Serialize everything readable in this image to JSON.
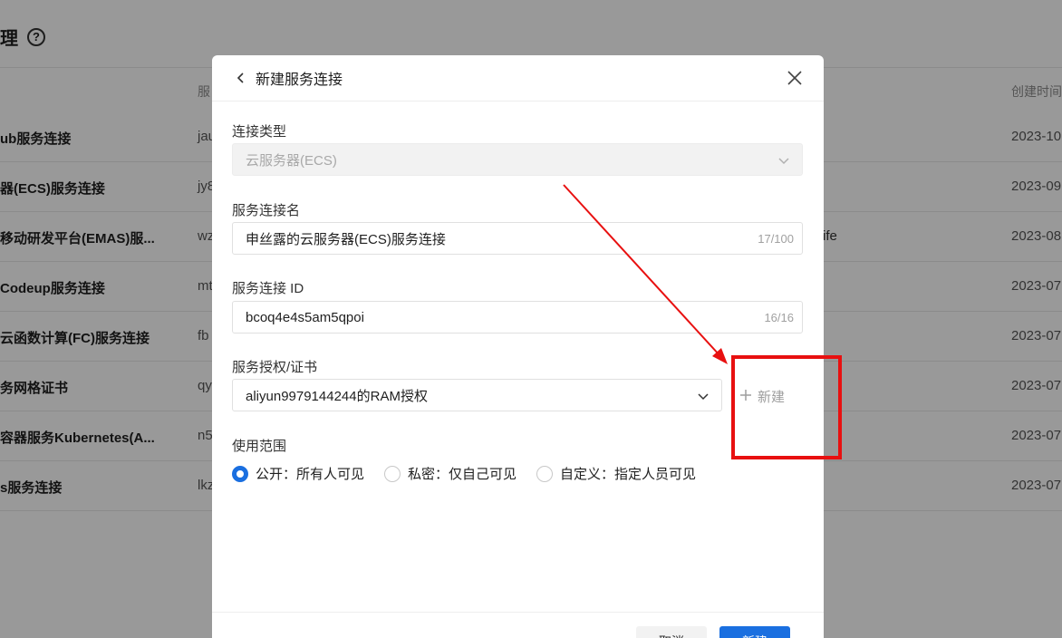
{
  "background": {
    "title": "理",
    "help_icon": "?",
    "column_headers": {
      "id": "服",
      "date": "创建时间"
    },
    "rows": [
      {
        "name": "ub服务连接",
        "id": "jau",
        "extra": "",
        "date": "2023-10"
      },
      {
        "name": "器(ECS)服务连接",
        "id": "jy8",
        "extra": "",
        "date": "2023-09"
      },
      {
        "name": "移动研发平台(EMAS)服...",
        "id": "wz",
        "extra": "ife",
        "date": "2023-08"
      },
      {
        "name": "Codeup服务连接",
        "id": "mt",
        "extra": "",
        "date": "2023-07"
      },
      {
        "name": "云函数计算(FC)服务连接",
        "id": "fb",
        "extra": "",
        "date": "2023-07"
      },
      {
        "name": "务网格证书",
        "id": "qy",
        "extra": "",
        "date": "2023-07"
      },
      {
        "name": "容器服务Kubernetes(A...",
        "id": "n5",
        "extra": "",
        "date": "2023-07"
      },
      {
        "name": "s服务连接",
        "id": "lkz",
        "extra": "",
        "date": "2023-07"
      }
    ]
  },
  "dialog": {
    "title": "新建服务连接",
    "connection_type": {
      "label": "连接类型",
      "value": "云服务器(ECS)"
    },
    "service_name": {
      "label": "服务连接名",
      "value": "申丝露的云服务器(ECS)服务连接",
      "counter": "17/100"
    },
    "service_id": {
      "label": "服务连接 ID",
      "value": "bcoq4e4s5am5qpoi",
      "counter": "16/16"
    },
    "authorization": {
      "label": "服务授权/证书",
      "value": "aliyun9979144244的RAM授权",
      "new_label": "新建"
    },
    "scope": {
      "label": "使用范围",
      "options": [
        {
          "label": "公开：所有人可见",
          "checked": true
        },
        {
          "label": "私密：仅自己可见",
          "checked": false
        },
        {
          "label": "自定义：指定人员可见",
          "checked": false
        }
      ]
    },
    "footer": {
      "cancel_label": "取消",
      "create_label": "新建"
    }
  },
  "colors": {
    "primary": "#1a6fe0",
    "annotation": "#e81010"
  }
}
